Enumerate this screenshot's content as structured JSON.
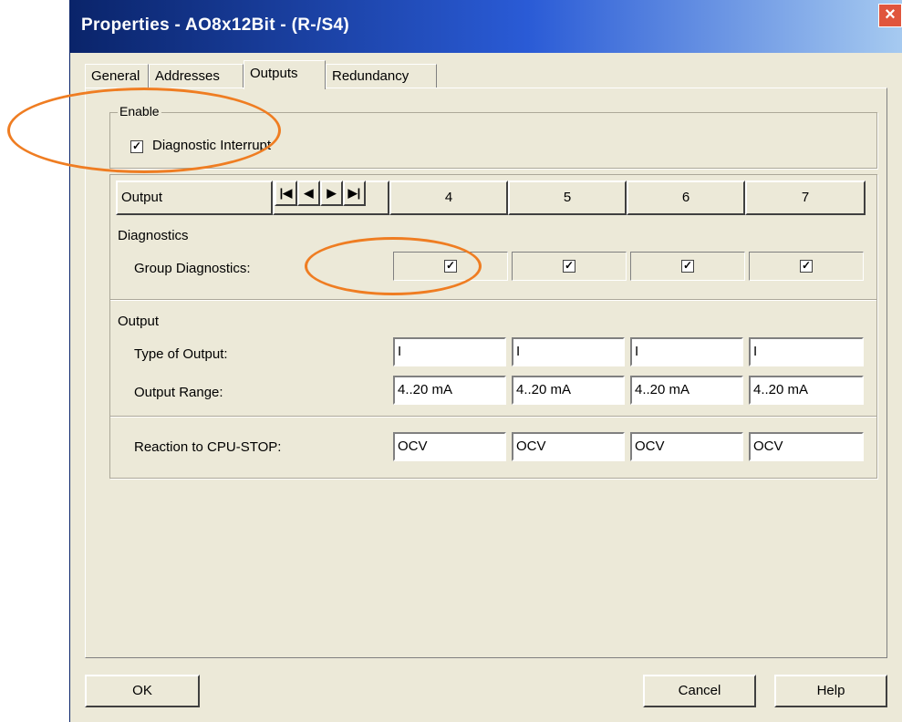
{
  "window": {
    "title": "Properties - AO8x12Bit - (R-/S4)"
  },
  "tabs": [
    "General",
    "Addresses",
    "Outputs",
    "Redundancy"
  ],
  "active_tab": "Outputs",
  "enable": {
    "legend": "Enable",
    "diagnostic_interrupt_label": "Diagnostic Interrupt",
    "diagnostic_interrupt_checked": true
  },
  "outputs_table": {
    "header_label": "Output",
    "channels": [
      "4",
      "5",
      "6",
      "7"
    ],
    "diagnostics_label": "Diagnostics",
    "group_diagnostics_label": "Group Diagnostics:",
    "group_diagnostics": [
      true,
      true,
      true,
      true
    ],
    "output_section_label": "Output",
    "type_of_output_label": "Type of Output:",
    "type_of_output": [
      "I",
      "I",
      "I",
      "I"
    ],
    "output_range_label": "Output Range:",
    "output_range": [
      "4..20 mA",
      "4..20 mA",
      "4..20 mA",
      "4..20 mA"
    ],
    "reaction_label": "Reaction to CPU-STOP:",
    "reaction": [
      "OCV",
      "OCV",
      "OCV",
      "OCV"
    ]
  },
  "buttons": {
    "ok": "OK",
    "cancel": "Cancel",
    "help": "Help"
  },
  "icons": {
    "close": "close-icon",
    "nav_first": "first-icon",
    "nav_prev": "prev-icon",
    "nav_next": "next-icon",
    "nav_last": "last-icon"
  },
  "annotation_color": "#ef7d22"
}
